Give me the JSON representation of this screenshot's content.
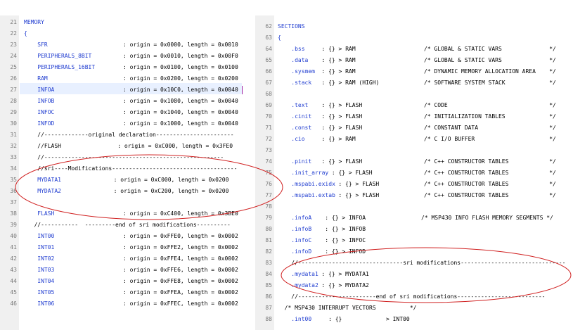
{
  "accent": "#1f3cd0",
  "ellipse_color": "#d02020",
  "left": {
    "lines": [
      {
        "n": "21",
        "k": "MEMORY",
        "v": ""
      },
      {
        "n": "22",
        "k": "{",
        "v": ""
      },
      {
        "n": "23",
        "k": "    SFR",
        "v": ": origin = 0x0000, length = 0x0010"
      },
      {
        "n": "24",
        "k": "    PERIPHERALS_8BIT",
        "v": ": origin = 0x0010, length = 0x00F0"
      },
      {
        "n": "25",
        "k": "    PERIPHERALS_16BIT",
        "v": ": origin = 0x0100, length = 0x0100"
      },
      {
        "n": "26",
        "k": "    RAM",
        "v": ": origin = 0x0200, length = 0x0200"
      },
      {
        "n": "27",
        "k": "    INFOA",
        "v": ": origin = 0x10C0, length = 0x0040"
      },
      {
        "n": "28",
        "k": "    INFOB",
        "v": ": origin = 0x1080, length = 0x0040"
      },
      {
        "n": "29",
        "k": "    INFOC",
        "v": ": origin = 0x1040, length = 0x0040"
      },
      {
        "n": "30",
        "k": "    INFOD",
        "v": ": origin = 0x1000, length = 0x0040"
      },
      {
        "n": "31",
        "k": "    //-------------original declaration-----------------------",
        "v": ""
      },
      {
        "n": "32",
        "k": "    //FLASH",
        "v": "    : origin = 0xC000, length = 0x3FE0"
      },
      {
        "n": "33",
        "k": "    //-----------------------------------------------------",
        "v": ""
      },
      {
        "n": "34",
        "k": "    //sri----Modifications-------------------------------------",
        "v": ""
      },
      {
        "n": "35",
        "k": "    MYDATA1",
        "v": "  : origin = 0xC000, length = 0x0200"
      },
      {
        "n": "36",
        "k": "    MYDATA2",
        "v": "  : origin = 0xC200, length = 0x0200"
      },
      {
        "n": "37",
        "k": "",
        "v": ""
      },
      {
        "n": "38",
        "k": "    FLASH",
        "v": ": origin = 0xC400, length = 0x3BE0"
      },
      {
        "n": "39",
        "k": "   //-----------  ---------end of sri modifications----------",
        "v": ""
      },
      {
        "n": "40",
        "k": "    INT00",
        "v": ": origin = 0xFFE0, length = 0x0002"
      },
      {
        "n": "41",
        "k": "    INT01",
        "v": ": origin = 0xFFE2, length = 0x0002"
      },
      {
        "n": "42",
        "k": "    INT02",
        "v": ": origin = 0xFFE4, length = 0x0002"
      },
      {
        "n": "43",
        "k": "    INT03",
        "v": ": origin = 0xFFE6, length = 0x0002"
      },
      {
        "n": "44",
        "k": "    INT04",
        "v": ": origin = 0xFFE8, length = 0x0002"
      },
      {
        "n": "45",
        "k": "    INT05",
        "v": ": origin = 0xFFEA, length = 0x0002"
      },
      {
        "n": "46",
        "k": "    INT06",
        "v": ": origin = 0xFFEC, length = 0x0002"
      }
    ]
  },
  "right": {
    "lines": [
      {
        "n": "62",
        "k": "SECTIONS",
        "m": "",
        "c": ""
      },
      {
        "n": "63",
        "k": "{",
        "m": "",
        "c": ""
      },
      {
        "n": "64",
        "k": "    .bss",
        "m": "     : {} > RAM",
        "c": "/* GLOBAL & STATIC VARS              */"
      },
      {
        "n": "65",
        "k": "    .data",
        "m": "    : {} > RAM",
        "c": "/* GLOBAL & STATIC VARS              */"
      },
      {
        "n": "66",
        "k": "    .sysmem",
        "m": "  : {} > RAM",
        "c": "/* DYNAMIC MEMORY ALLOCATION AREA    */"
      },
      {
        "n": "67",
        "k": "    .stack",
        "m": "   : {} > RAM (HIGH)",
        "c": "/* SOFTWARE SYSTEM STACK             */"
      },
      {
        "n": "68",
        "k": "",
        "m": "",
        "c": ""
      },
      {
        "n": "69",
        "k": "    .text",
        "m": "    : {} > FLASH",
        "c": "/* CODE                              */"
      },
      {
        "n": "70",
        "k": "    .cinit",
        "m": "   : {} > FLASH",
        "c": "/* INITIALIZATION TABLES             */"
      },
      {
        "n": "71",
        "k": "    .const",
        "m": "   : {} > FLASH",
        "c": "/* CONSTANT DATA                     */"
      },
      {
        "n": "72",
        "k": "    .cio",
        "m": "     : {} > RAM",
        "c": "/* C I/O BUFFER                      */"
      },
      {
        "n": "73",
        "k": "",
        "m": "",
        "c": ""
      },
      {
        "n": "74",
        "k": "    .pinit",
        "m": "   : {} > FLASH",
        "c": "/* C++ CONSTRUCTOR TABLES            */"
      },
      {
        "n": "75",
        "k": "    .init_array",
        "m": " : {} > FLASH",
        "c": "/* C++ CONSTRUCTOR TABLES            */"
      },
      {
        "n": "76",
        "k": "    .mspabi.exidx",
        "m": " : {} > FLASH",
        "c": "/* C++ CONSTRUCTOR TABLES            */"
      },
      {
        "n": "77",
        "k": "    .mspabi.extab",
        "m": " : {} > FLASH",
        "c": "/* C++ CONSTRUCTOR TABLES            */"
      },
      {
        "n": "78",
        "k": "",
        "m": "",
        "c": ""
      },
      {
        "n": "79",
        "k": "    .infoA",
        "m": "    : {} > INFOA",
        "c": "/* MSP430 INFO FLASH MEMORY SEGMENTS */"
      },
      {
        "n": "80",
        "k": "    .infoB",
        "m": "    : {} > INFOB",
        "c": ""
      },
      {
        "n": "81",
        "k": "    .infoC",
        "m": "    : {} > INFOC",
        "c": ""
      },
      {
        "n": "82",
        "k": "    .infoD",
        "m": "    : {} > INFOD",
        "c": ""
      },
      {
        "n": "83",
        "k": "    //-------------------------------sri modifications-------------------------------",
        "m": "",
        "c": ""
      },
      {
        "n": "84",
        "k": "    .mydata1",
        "m": " : {} > MYDATA1",
        "c": ""
      },
      {
        "n": "85",
        "k": "    .mydata2",
        "m": " : {} > MYDATA2",
        "c": ""
      },
      {
        "n": "86",
        "k": "    //-----------------------end of sri modifications--------------------------",
        "m": "",
        "c": ""
      },
      {
        "n": "87",
        "k": "  /* MSP430 INTERRUPT VECTORS          */",
        "m": "",
        "c": ""
      },
      {
        "n": "88",
        "k": "    .int00",
        "m": "     : {}             > INT00",
        "c": ""
      }
    ]
  }
}
